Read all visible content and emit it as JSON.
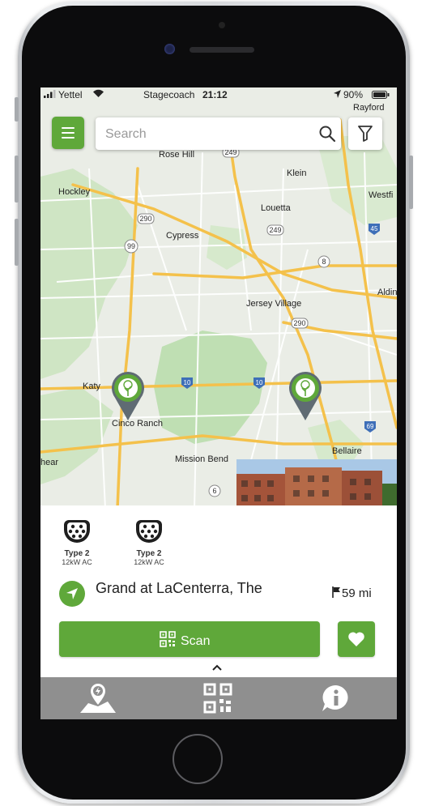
{
  "status_bar": {
    "carrier": "Yettel",
    "location_name": "Stagecoach",
    "time": "21:12",
    "battery": "90%"
  },
  "search": {
    "placeholder": "Search"
  },
  "map": {
    "place_labels": [
      "Rayford",
      "Rose Hill",
      "Klein",
      "Hockley",
      "Westfi",
      "Louetta",
      "Cypress",
      "Aldin",
      "Jersey Village",
      "Katy",
      "Cinco Ranch",
      "Bellaire",
      "Mission Bend",
      "hear"
    ],
    "road_shields": [
      "249",
      "290",
      "249",
      "99",
      "8",
      "290",
      "10",
      "10",
      "45",
      "69",
      "6"
    ],
    "pins": 2
  },
  "station": {
    "connectors": [
      {
        "type": "Type 2",
        "power": "12kW AC"
      },
      {
        "type": "Type 2",
        "power": "12kW AC"
      }
    ],
    "name": "Grand at LaCenterra, The",
    "distance": "59 mi"
  },
  "actions": {
    "scan_label": "Scan"
  },
  "tabs": [
    {
      "icon": "map-charger-icon"
    },
    {
      "icon": "qr-code-icon"
    },
    {
      "icon": "info-icon"
    }
  ],
  "colors": {
    "brand_green": "#5fa83a",
    "tab_bar_gray": "#8f8f8f",
    "map_water_park": "#c4e3bd",
    "highway": "#f4c14b"
  }
}
